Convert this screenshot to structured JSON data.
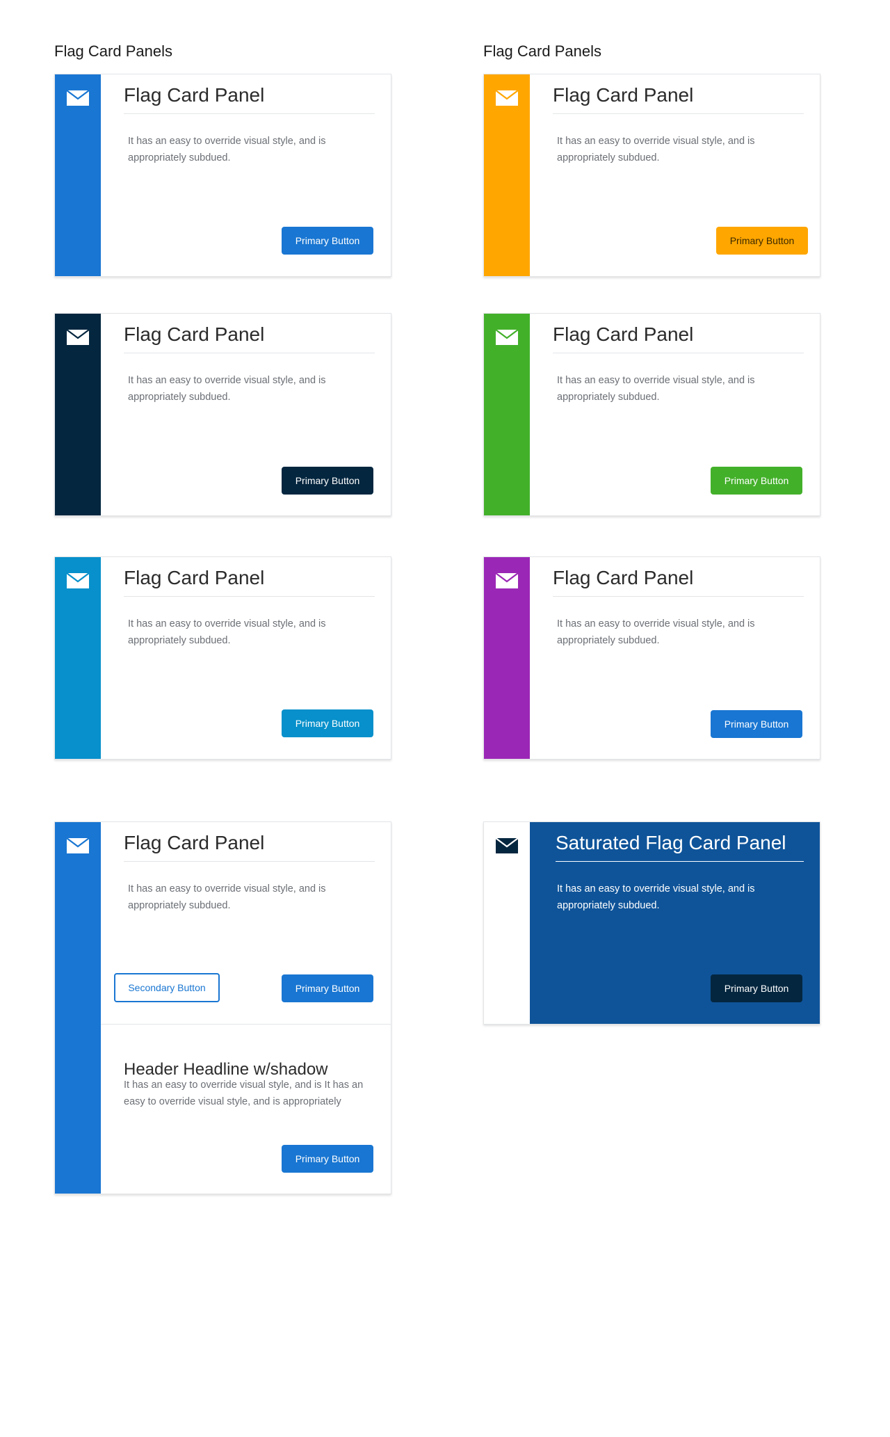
{
  "sections": {
    "left_title": "Flag Card Panels",
    "right_title": "Flag Card Panels"
  },
  "colors": {
    "blue": "#1976d2",
    "orange": "#ffa600",
    "navy": "#04263f",
    "green": "#43b02a",
    "cyan": "#0790cb",
    "purple": "#9b27b6",
    "saturated_bg": "#0f5499"
  },
  "cards": [
    {
      "title": "Flag Card Panel",
      "body": "It has an easy to override visual style, and is appropriately subdued.",
      "primary_label": "Primary Button",
      "flag_color": "#1976d2",
      "button_color": "#1976d2",
      "icon": "envelope-icon"
    },
    {
      "title": "Flag Card Panel",
      "body": "It has an easy to override visual style, and is appropriately subdued.",
      "primary_label": "Primary Button",
      "flag_color": "#ffa600",
      "button_color": "#ffa600",
      "icon": "envelope-icon"
    },
    {
      "title": "Flag Card Panel",
      "body": "It has an easy to override visual style, and is appropriately subdued.",
      "primary_label": "Primary Button",
      "flag_color": "#04263f",
      "button_color": "#04263f",
      "icon": "envelope-icon"
    },
    {
      "title": "Flag Card Panel",
      "body": "It has an easy to override visual style, and is appropriately subdued.",
      "primary_label": "Primary Button",
      "flag_color": "#43b02a",
      "button_color": "#43b02a",
      "icon": "envelope-icon"
    },
    {
      "title": "Flag Card Panel",
      "body": "It has an easy to override visual style, and is appropriately subdued.",
      "primary_label": "Primary Button",
      "flag_color": "#0790cb",
      "button_color": "#0790cb",
      "icon": "envelope-icon"
    },
    {
      "title": "Flag Card Panel",
      "body": "It has an easy to override visual style, and is appropriately subdued.",
      "primary_label": "Primary Button",
      "flag_color": "#9b27b6",
      "button_color": "#1976d2",
      "icon": "envelope-icon"
    },
    {
      "title": "Flag Card Panel",
      "body": "It has an easy to override visual style, and is appropriately subdued.",
      "primary_label": "Primary Button",
      "secondary_label": "Secondary Button",
      "flag_color": "#1976d2",
      "button_color": "#1976d2",
      "icon": "envelope-icon",
      "sub": {
        "title": "Header Headline w/shadow",
        "body": "It has an easy to override visual style, and is It has an easy to override visual style, and is appropriately",
        "primary_label": "Primary Button"
      }
    },
    {
      "title": "Saturated Flag Card Panel",
      "body": "It has an easy to override visual style, and is appropriately subdued.",
      "primary_label": "Primary Button",
      "flag_color": "#ffffff",
      "button_color": "#04263f",
      "icon": "envelope-icon"
    }
  ]
}
